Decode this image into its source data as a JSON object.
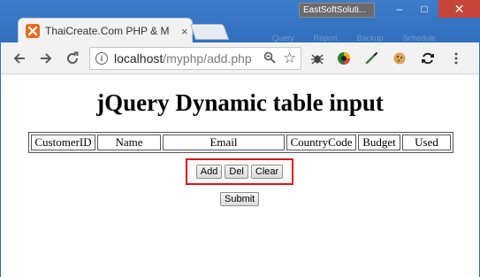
{
  "browser": {
    "tab_title": "ThaiCreate.Com PHP & M",
    "tab_close": "×",
    "favicon_color": "#ec6a1e",
    "user_chip": "EastSoftSoluti...",
    "window_controls": {
      "minimize": "–",
      "maximize": "□",
      "close": "✕"
    },
    "background_tabs": [
      "",
      "Query",
      "Report",
      "Backup",
      "Schedule"
    ]
  },
  "toolbar": {
    "back_icon": "arrow-left-icon",
    "forward_icon": "arrow-right-icon",
    "reload_icon": "reload-icon",
    "url_host": "localhost",
    "url_path": "/myphp/add.php",
    "extensions": [
      "bug-icon",
      "colorful-circle-icon",
      "pen-icon",
      "cookie-icon",
      "sync-icon",
      "more-vert-icon"
    ]
  },
  "page": {
    "title": "jQuery Dynamic table input",
    "columns": [
      "CustomerID",
      "Name",
      "Email",
      "CountryCode",
      "Budget",
      "Used"
    ],
    "buttons": {
      "add": "Add",
      "del": "Del",
      "clear": "Clear"
    },
    "submit": "Submit",
    "highlight_color": "#d9141c"
  }
}
